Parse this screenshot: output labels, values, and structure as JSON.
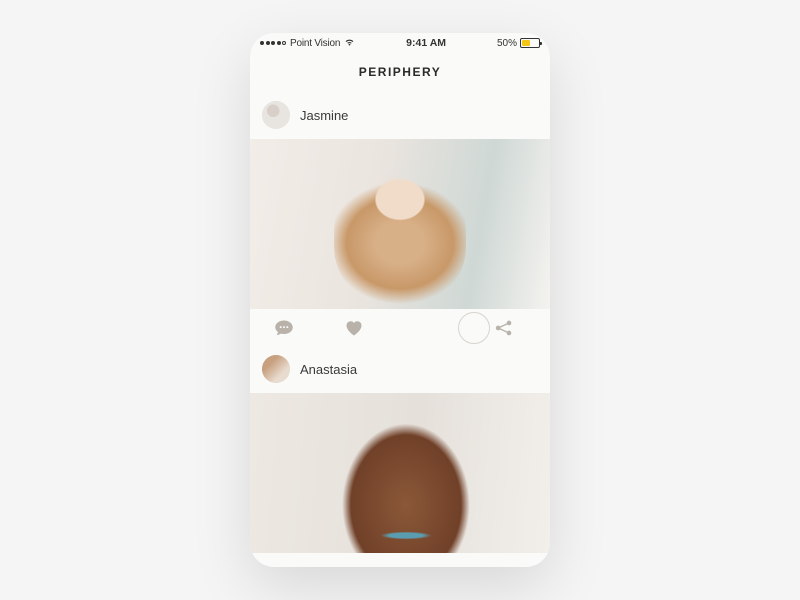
{
  "status": {
    "carrier": "Point Vision",
    "time": "9:41 AM",
    "battery_pct": "50%"
  },
  "header": {
    "title": "PERIPHERY"
  },
  "feed": [
    {
      "username": "Jasmine"
    },
    {
      "username": "Anastasia"
    }
  ]
}
